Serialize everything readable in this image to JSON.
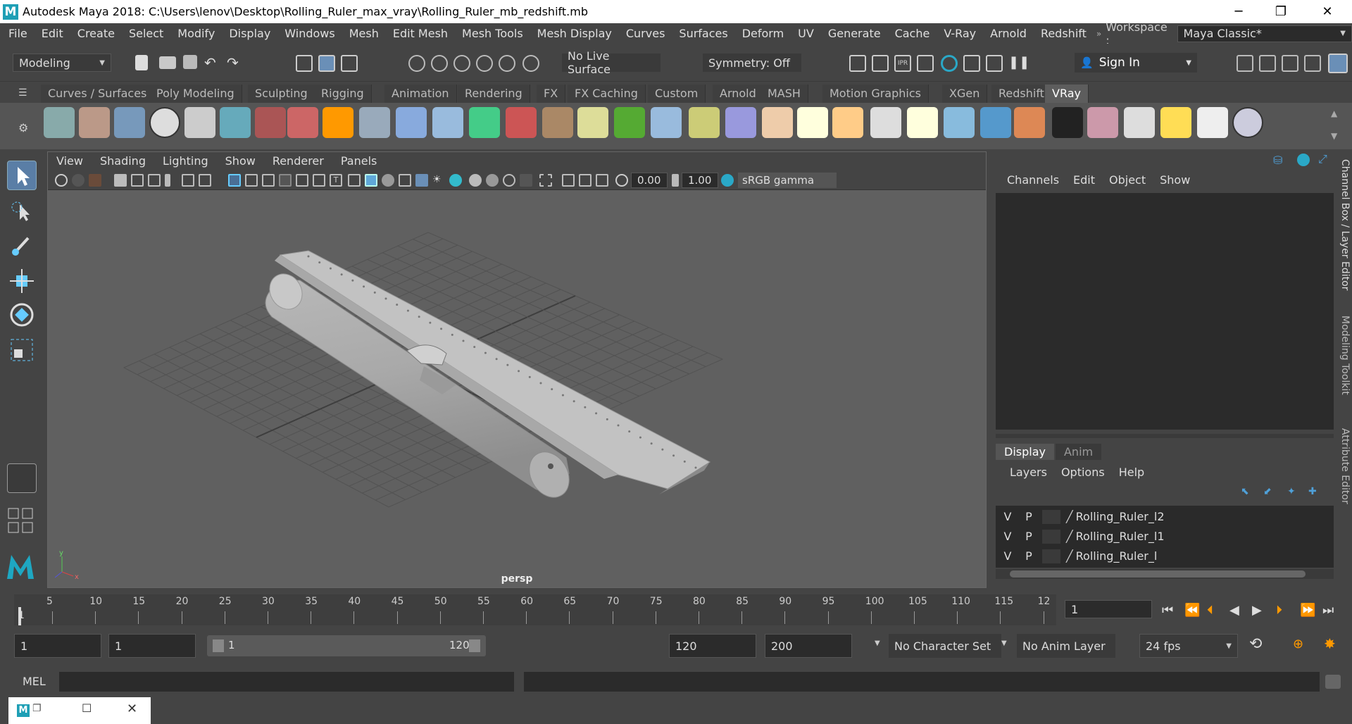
{
  "window": {
    "title": "Autodesk Maya 2018: C:\\Users\\lenov\\Desktop\\Rolling_Ruler_max_vray\\Rolling_Ruler_mb_redshift.mb",
    "logo_letter": "M",
    "minimize": "─",
    "maximize": "❐",
    "close": "✕"
  },
  "menubar": {
    "items": [
      "File",
      "Edit",
      "Create",
      "Select",
      "Modify",
      "Display",
      "Windows",
      "Mesh",
      "Edit Mesh",
      "Mesh Tools",
      "Mesh Display",
      "Curves",
      "Surfaces",
      "Deform",
      "UV",
      "Generate",
      "Cache",
      "V-Ray",
      "Arnold",
      "Redshift"
    ],
    "workspace_label": "Workspace :",
    "workspace_value": "Maya Classic*"
  },
  "statusline": {
    "menuset": "Modeling",
    "live_surface": "No Live Surface",
    "symmetry": "Symmetry: Off",
    "sign_in": "Sign In"
  },
  "shelf_tabs": [
    "Curves / Surfaces",
    "Poly Modeling",
    "Sculpting",
    "Rigging",
    "Animation",
    "Rendering",
    "FX",
    "FX Caching",
    "Custom",
    "Arnold",
    "MASH",
    "Motion Graphics",
    "XGen",
    "Redshift",
    "VRay"
  ],
  "shelf_active": "VRay",
  "viewport": {
    "menu": [
      "View",
      "Shading",
      "Lighting",
      "Show",
      "Renderer",
      "Panels"
    ],
    "exposure": "0.00",
    "gamma": "1.00",
    "colorspace": "sRGB gamma",
    "camera_label": "persp",
    "axis_x": "x",
    "axis_y": "y"
  },
  "channelbox": {
    "menu": [
      "Channels",
      "Edit",
      "Object",
      "Show"
    ],
    "tabs": [
      "Display",
      "Anim"
    ],
    "layer_menu": [
      "Layers",
      "Options",
      "Help"
    ],
    "layers": [
      {
        "v": "V",
        "p": "P",
        "name": "Rolling_Ruler_l2"
      },
      {
        "v": "V",
        "p": "P",
        "name": "Rolling_Ruler_l1"
      },
      {
        "v": "V",
        "p": "P",
        "name": "Rolling_Ruler_l"
      }
    ],
    "side_tabs": [
      "Channel Box / Layer Editor",
      "Modeling Toolkit",
      "Attribute Editor"
    ]
  },
  "timeslider": {
    "ticks": [
      "5",
      "10",
      "15",
      "20",
      "25",
      "30",
      "35",
      "40",
      "45",
      "50",
      "55",
      "60",
      "65",
      "70",
      "75",
      "80",
      "85",
      "90",
      "95",
      "100",
      "105",
      "110",
      "115",
      "12"
    ],
    "start_label": "1",
    "current_frame": "1"
  },
  "range": {
    "start": "1",
    "playback_start": "1",
    "slider_start": "1",
    "slider_end": "120",
    "playback_end": "120",
    "end": "200",
    "character_set": "No Character Set",
    "anim_layer": "No Anim Layer",
    "fps": "24 fps"
  },
  "cmdline": {
    "label": "MEL"
  }
}
